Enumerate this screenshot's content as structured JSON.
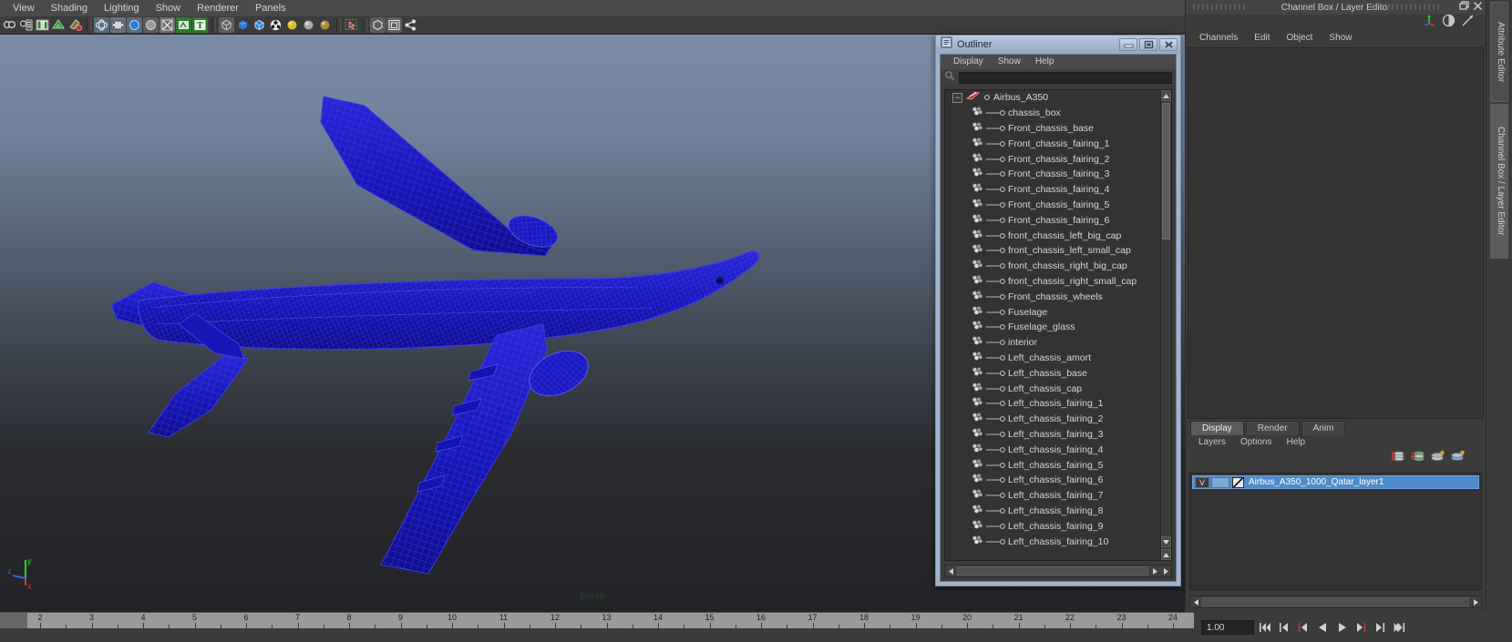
{
  "viewport": {
    "menu": [
      "View",
      "Shading",
      "Lighting",
      "Show",
      "Renderer",
      "Panels"
    ],
    "camera_label": "persp",
    "axis": {
      "x": "x",
      "y": "y",
      "z": "z"
    },
    "model_color": "#1414c8",
    "background_top": "#7a8da4",
    "background_bottom": "#222327",
    "toolbar_icons": [
      "select-camera-icon",
      "render-settings-icon",
      "render-view-icon",
      "ipr-render-icon",
      "render-region-icon",
      "separator",
      "smooth-shade-icon",
      "filmgate-icon",
      "resolution-gate-icon",
      "gate-mask-icon",
      "xray-icon",
      "xray-joints-icon",
      "text-overlay-icon",
      "separator",
      "wireframe-icon",
      "smooth-shade-all-icon",
      "flat-shade-icon",
      "wireframe-on-shaded-icon",
      "light-default-icon",
      "light-all-icon",
      "light-shadow-icon",
      "separator",
      "isolate-select-icon",
      "separator",
      "xray-toggle-icon",
      "xray-active-icon",
      "xray-joints-toggle-icon"
    ]
  },
  "outliner": {
    "title": "Outliner",
    "title_icon": "outliner-window-icon",
    "window_buttons": [
      {
        "name": "minimize-button",
        "glyph": "minimize"
      },
      {
        "name": "maximize-button",
        "glyph": "maximize"
      },
      {
        "name": "close-button",
        "glyph": "close"
      }
    ],
    "menu": [
      "Display",
      "Show",
      "Help"
    ],
    "search_placeholder": "",
    "search_value": "",
    "root": {
      "label": "Airbus_A350",
      "icon": "group-transform-icon",
      "expanded": true
    },
    "children": [
      "chassis_box",
      "Front_chassis_base",
      "Front_chassis_fairing_1",
      "Front_chassis_fairing_2",
      "Front_chassis_fairing_3",
      "Front_chassis_fairing_4",
      "Front_chassis_fairing_5",
      "Front_chassis_fairing_6",
      "front_chassis_left_big_cap",
      "front_chassis_left_small_cap",
      "front_chassis_right_big_cap",
      "front_chassis_right_small_cap",
      "Front_chassis_wheels",
      "Fuselage",
      "Fuselage_glass",
      "interior",
      "Left_chassis_amort",
      "Left_chassis_base",
      "Left_chassis_cap",
      "Left_chassis_fairing_1",
      "Left_chassis_fairing_2",
      "Left_chassis_fairing_3",
      "Left_chassis_fairing_4",
      "Left_chassis_fairing_5",
      "Left_chassis_fairing_6",
      "Left_chassis_fairing_7",
      "Left_chassis_fairing_8",
      "Left_chassis_fairing_9",
      "Left_chassis_fairing_10"
    ]
  },
  "right_dock": {
    "title": "Channel Box / Layer Editor",
    "close_buttons": [
      "restore-button",
      "close-button"
    ],
    "quick_icons": [
      "show-manipulator-icon",
      "half-tone-icon",
      "input-output-icon"
    ],
    "menu": [
      "Channels",
      "Edit",
      "Object",
      "Show"
    ],
    "layer_editor": {
      "tabs": [
        {
          "label": "Display",
          "active": true
        },
        {
          "label": "Render",
          "active": false
        },
        {
          "label": "Anim",
          "active": false
        }
      ],
      "menu": [
        "Layers",
        "Options",
        "Help"
      ],
      "toolbar_icons": [
        "new-layer-icon",
        "new-layer-from-selection-icon",
        "layer-up-icon",
        "layer-down-icon"
      ],
      "layers": [
        {
          "visibility": "V",
          "playback": "",
          "name": "Airbus_A350_1000_Qatar_layer1",
          "selected": true
        }
      ]
    }
  },
  "vertical_tabs": [
    {
      "label": "Attribute Editor",
      "active": false
    },
    {
      "label": "Channel Box / Layer Editor",
      "active": true
    }
  ],
  "timeline": {
    "ticks": [
      2,
      3,
      4,
      5,
      6,
      7,
      8,
      9,
      10,
      11,
      12,
      13,
      14,
      15,
      16,
      17,
      18,
      19,
      20,
      21,
      22,
      23,
      24
    ],
    "current_frame": "1.00"
  },
  "playback": {
    "current_time": "1.00",
    "buttons": [
      "go-to-start-icon",
      "step-back-frame-icon",
      "step-back-key-icon",
      "play-backwards-icon",
      "play-forwards-icon",
      "step-forward-key-icon",
      "step-forward-frame-icon",
      "go-to-end-icon"
    ]
  }
}
